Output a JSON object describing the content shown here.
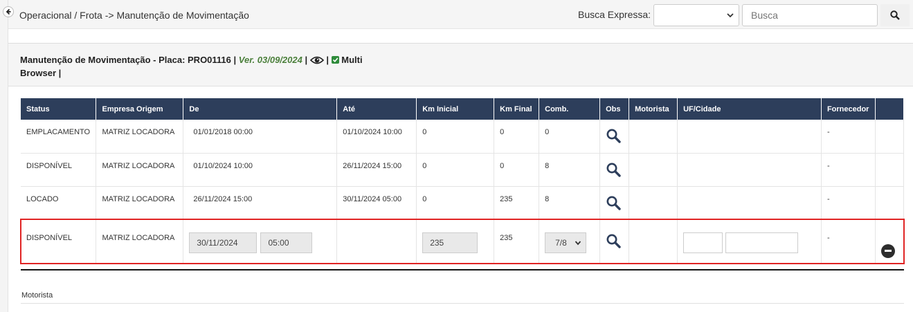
{
  "breadcrumb": "Operacional / Frota -> Manutenção de Movimentação",
  "busca": {
    "label": "Busca Expressa:",
    "placeholder": "Busca"
  },
  "panel": {
    "title_main": "Manutenção de Movimentação - Placa: PRO01116",
    "sep": "|",
    "version": "Ver. 03/09/2024",
    "multi_label": "Multi",
    "browser_label": "Browser"
  },
  "table": {
    "headers": [
      "Status",
      "Empresa Origem",
      "De",
      "Até",
      "Km Inicial",
      "Km Final",
      "Comb.",
      "Obs",
      "Motorista",
      "UF/Cidade",
      "Fornecedor",
      ""
    ],
    "rows": [
      {
        "status": "EMPLACAMENTO",
        "empresa": "MATRIZ LOCADORA",
        "de": "01/01/2018 00:00",
        "ate": "01/10/2024 10:00",
        "km_inicial": "0",
        "km_final": "0",
        "comb": "0",
        "motorista": "",
        "uf_cidade": "",
        "fornecedor": "-"
      },
      {
        "status": "DISPONÍVEL",
        "empresa": "MATRIZ LOCADORA",
        "de": "01/10/2024 10:00",
        "ate": "26/11/2024 15:00",
        "km_inicial": "0",
        "km_final": "0",
        "comb": "8",
        "motorista": "",
        "uf_cidade": "",
        "fornecedor": "-"
      },
      {
        "status": "LOCADO",
        "empresa": "MATRIZ LOCADORA",
        "de": "26/11/2024 15:00",
        "ate": "30/11/2024 05:00",
        "km_inicial": "0",
        "km_final": "235",
        "comb": "8",
        "motorista": "",
        "uf_cidade": "",
        "fornecedor": "-"
      }
    ],
    "edit_row": {
      "status": "DISPONÍVEL",
      "empresa": "MATRIZ LOCADORA",
      "de_date": "30/11/2024",
      "de_time": "05:00",
      "km_inicial": "235",
      "km_final": "235",
      "comb": "7/8",
      "uf": "",
      "cidade": "",
      "fornecedor": "-"
    }
  },
  "motorista_section": {
    "label": "Motorista"
  },
  "colors": {
    "header_bg": "#2d3e5b",
    "highlight": "#e02424",
    "version_green": "#4a7f3a"
  }
}
